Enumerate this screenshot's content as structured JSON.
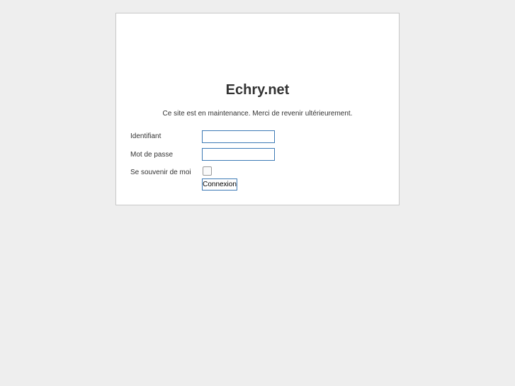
{
  "title": "Echry.net",
  "message": "Ce site est en maintenance. Merci de revenir ultérieurement.",
  "form": {
    "username_label": "Identifiant",
    "username_value": "",
    "password_label": "Mot de passe",
    "password_value": "",
    "remember_label": "Se souvenir de moi",
    "remember_checked": false,
    "submit_label": "Connexion"
  },
  "colors": {
    "background": "#eeeeee",
    "input_border": "#3d7ab5"
  }
}
